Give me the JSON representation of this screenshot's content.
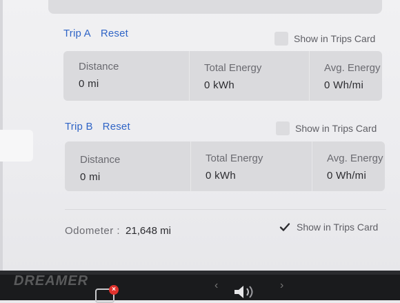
{
  "trip_a": {
    "title": "Trip A",
    "reset_label": "Reset",
    "show_in_trips_card_label": "Show in Trips Card",
    "show_in_trips_card_checked": false,
    "stats": [
      {
        "label": "Distance",
        "value": "0 mi"
      },
      {
        "label": "Total Energy",
        "value": "0 kWh"
      },
      {
        "label": "Avg. Energy",
        "value": "0 Wh/mi"
      }
    ]
  },
  "trip_b": {
    "title": "Trip B",
    "reset_label": "Reset",
    "show_in_trips_card_label": "Show in Trips Card",
    "show_in_trips_card_checked": false,
    "stats": [
      {
        "label": "Distance",
        "value": "0 mi"
      },
      {
        "label": "Total Energy",
        "value": "0 kWh"
      },
      {
        "label": "Avg. Energy",
        "value": "0 Wh/mi"
      }
    ]
  },
  "odometer": {
    "label": "Odometer :",
    "value": "21,648 mi",
    "show_in_trips_card_label": "Show in Trips Card",
    "show_in_trips_card_checked": true
  },
  "taskbar": {
    "watermark": "DREAMER",
    "close_badge": "×",
    "icons": [
      "camera-icon",
      "volume-icon",
      "chevron-left-icon",
      "chevron-right-icon"
    ]
  },
  "colors": {
    "accent": "#2f64c6",
    "background": "#ececef",
    "card": "#dadadd",
    "taskbar": "#1a1b1d",
    "badge": "#e0322d"
  }
}
